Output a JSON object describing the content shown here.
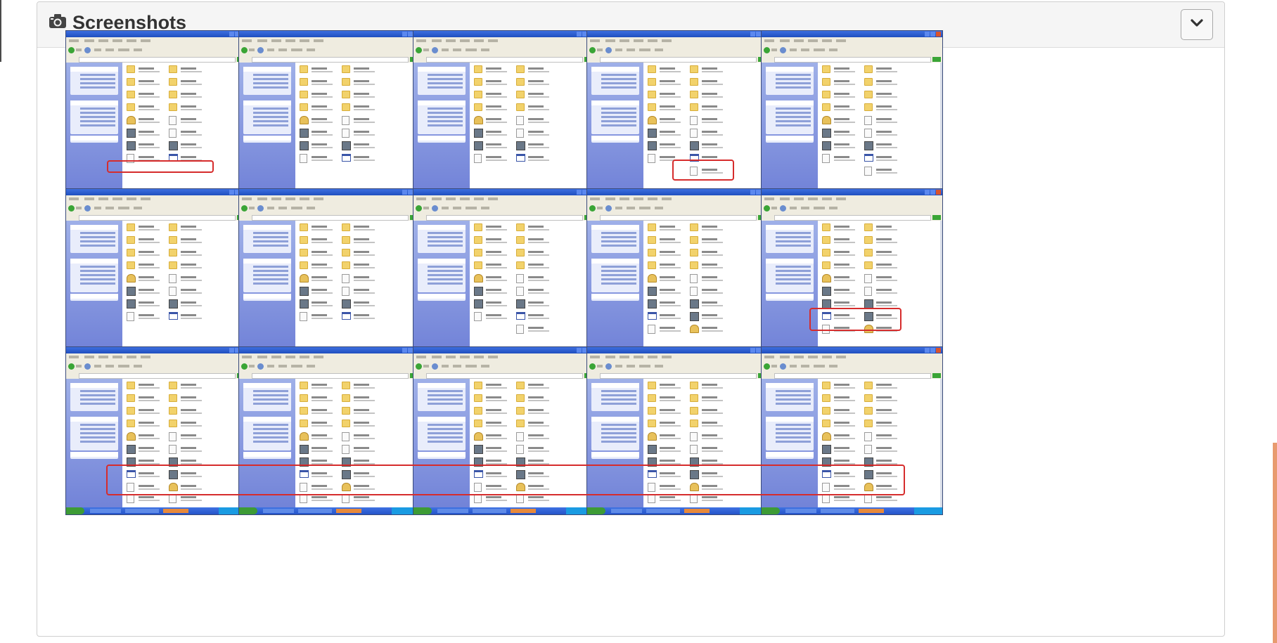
{
  "panel": {
    "title": "Screenshots",
    "camera_icon": "camera-icon",
    "collapse_icon": "chevron-down-icon"
  },
  "grid": {
    "rows": 3,
    "columns": 5,
    "thumbnail_count": 15,
    "highlight_color": "#d62c2c"
  },
  "colors": {
    "panel_header": "#f5f5f5",
    "panel_border": "#cfcfcf",
    "accent_right": "#e89b6f"
  }
}
